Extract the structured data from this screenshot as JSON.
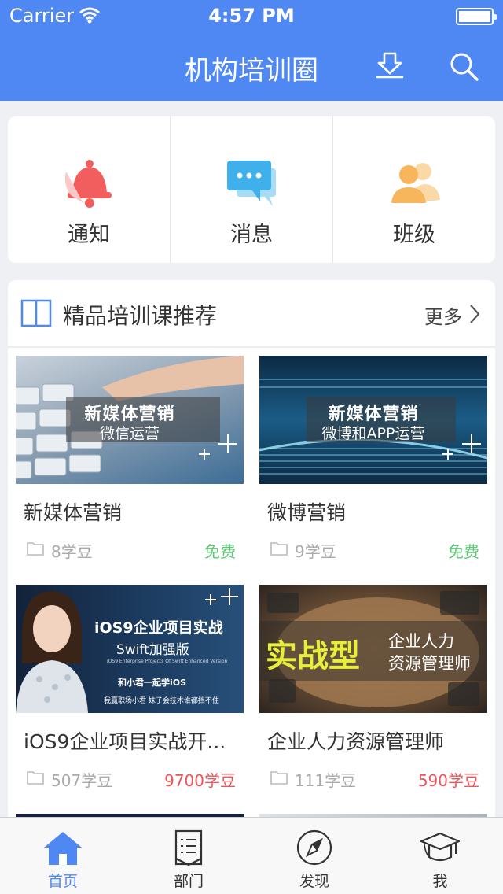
{
  "status_bar": {
    "carrier": "Carrier",
    "time": "4:57 PM"
  },
  "nav": {
    "title": "机构培训圈",
    "download_icon": "download-icon",
    "search_icon": "search-icon"
  },
  "quick_actions": [
    {
      "label": "通知",
      "icon": "bell-icon",
      "color": "#f25e5e"
    },
    {
      "label": "消息",
      "icon": "chat-bubbles-icon",
      "color": "#3fb0ea"
    },
    {
      "label": "班级",
      "icon": "people-icon",
      "color": "#f7b55c"
    }
  ],
  "featured": {
    "title": "精品培训课推荐",
    "more": "更多",
    "courses": [
      {
        "title": "新媒体营销",
        "beans": "8学豆",
        "price": "免费",
        "thumb_caption": "新媒体营销",
        "thumb_subcaption": "微信运营"
      },
      {
        "title": "微博营销",
        "beans": "9学豆",
        "price": "免费",
        "thumb_caption": "新媒体营销",
        "thumb_subcaption": "微博和APP运营"
      },
      {
        "title": "iOS9企业项目实战开...",
        "beans": "507学豆",
        "price": "9700学豆",
        "thumb_caption": "iOS9企业项目实战",
        "thumb_subcaption": "Swift加强版",
        "thumb_line3": "iOS9 Enterprise Projects Of Swift Enhanced Version",
        "thumb_line4": "和小君一起学iOS",
        "thumb_line5": "我赢职场小君 妹子会技术谁都挡不住"
      },
      {
        "title": "企业人力资源管理师",
        "beans": "111学豆",
        "price": "590学豆",
        "thumb_caption": "实战型",
        "thumb_subcaption": "企业人力",
        "thumb_line3": "资源管理师"
      }
    ]
  },
  "tabs": [
    {
      "label": "首页",
      "icon": "home-icon",
      "active": true
    },
    {
      "label": "部门",
      "icon": "list-doc-icon",
      "active": false
    },
    {
      "label": "发现",
      "icon": "compass-icon",
      "active": false
    },
    {
      "label": "我",
      "icon": "graduation-cap-icon",
      "active": false
    }
  ],
  "colors": {
    "brand": "#4f88f3",
    "free": "#5cc873",
    "paid": "#f0555a"
  }
}
